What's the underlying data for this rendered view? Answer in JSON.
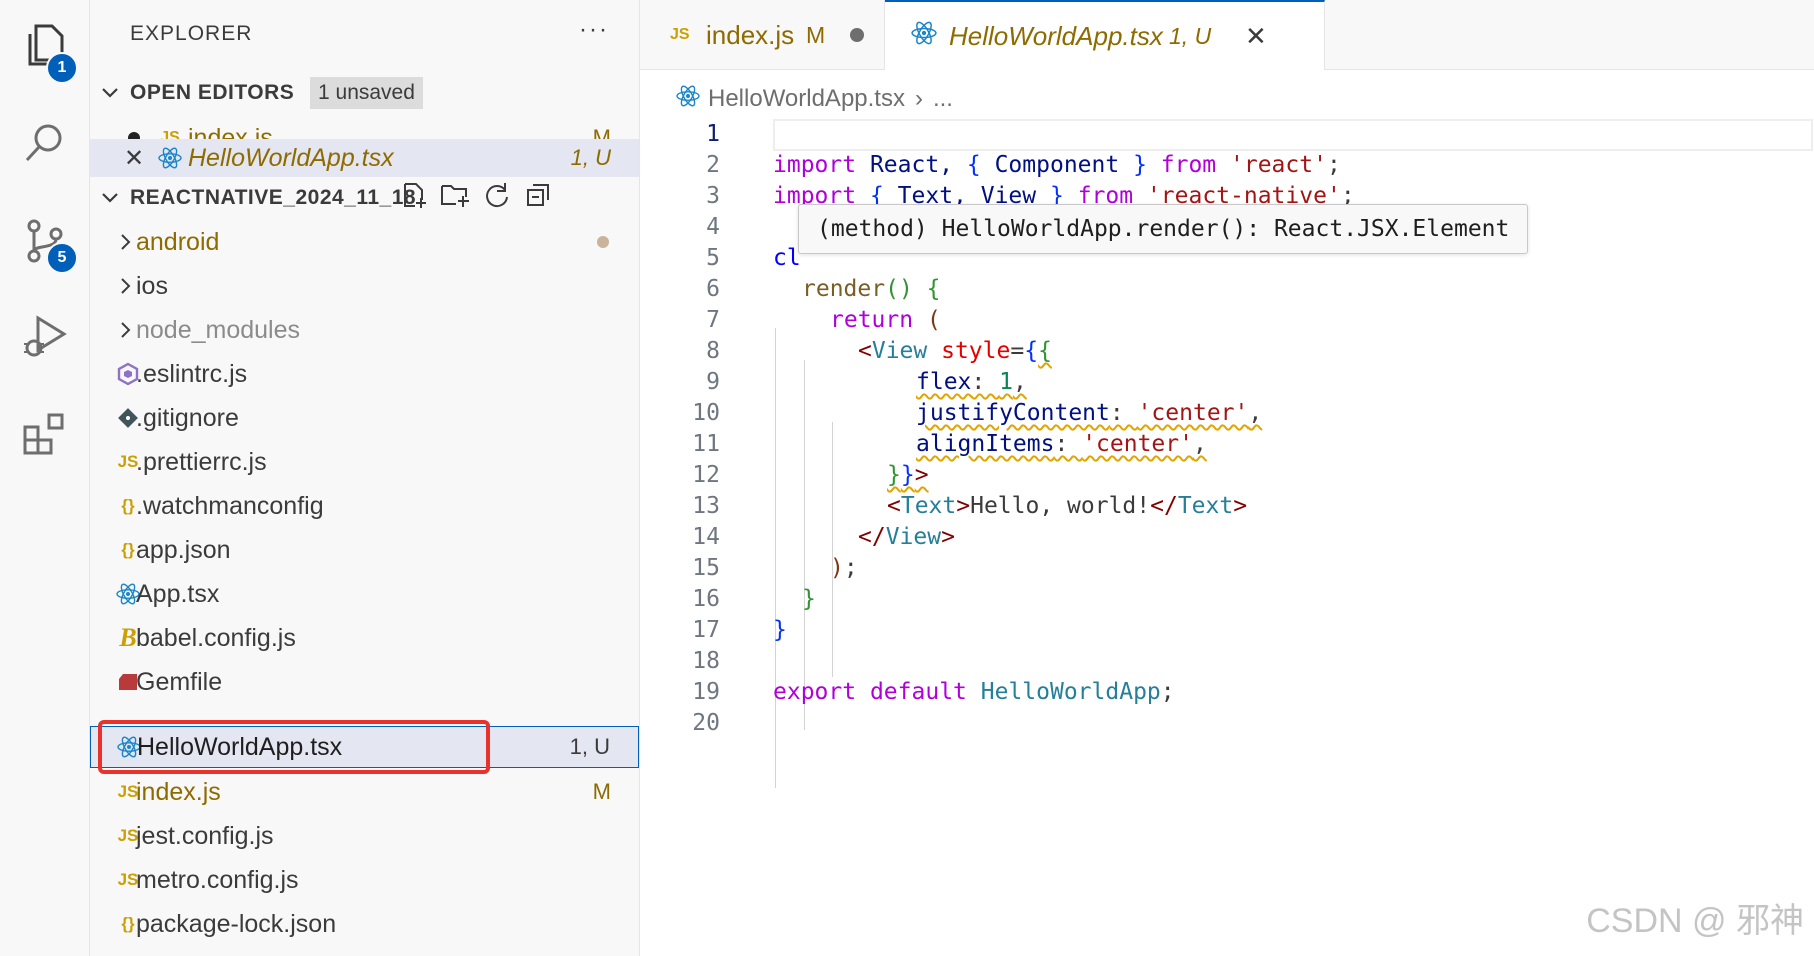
{
  "activity_bar": {
    "explorer_badge": "1",
    "scm_badge": "5"
  },
  "explorer": {
    "title": "EXPLORER",
    "more_label": "···",
    "open_editors": {
      "header": "OPEN EDITORS",
      "unsaved_badge": "1 unsaved",
      "items": [
        {
          "icon": "JS",
          "name": "index.js",
          "status": "M"
        },
        {
          "icon": "react",
          "name": "HelloWorldApp.tsx",
          "status": "1, U"
        }
      ]
    },
    "project": {
      "header": "REACTNATIVE_2024_11_18",
      "folders": [
        {
          "name": "android"
        },
        {
          "name": "ios"
        },
        {
          "name": "node_modules"
        }
      ],
      "files": [
        {
          "icon": "eslint",
          "name": ".eslintrc.js",
          "status": ""
        },
        {
          "icon": "git",
          "name": ".gitignore",
          "status": ""
        },
        {
          "icon": "JS",
          "name": ".prettierrc.js",
          "status": ""
        },
        {
          "icon": "{}",
          "name": ".watchmanconfig",
          "status": ""
        },
        {
          "icon": "{}",
          "name": "app.json",
          "status": ""
        },
        {
          "icon": "react",
          "name": "App.tsx",
          "status": ""
        },
        {
          "icon": "babel",
          "name": "babel.config.js",
          "status": ""
        },
        {
          "icon": "ruby",
          "name": "Gemfile",
          "status": ""
        },
        {
          "icon": "react",
          "name": "HelloWorldApp.tsx",
          "status": "1, U"
        },
        {
          "icon": "JS",
          "name": "index.js",
          "status": "M"
        },
        {
          "icon": "JS",
          "name": "jest.config.js",
          "status": ""
        },
        {
          "icon": "JS",
          "name": "metro.config.js",
          "status": ""
        },
        {
          "icon": "{}",
          "name": "package-lock.json",
          "status": ""
        }
      ]
    }
  },
  "tabs": [
    {
      "icon": "JS",
      "name": "index.js",
      "status": "M"
    },
    {
      "icon": "react",
      "name": "HelloWorldApp.tsx",
      "status": "1, U"
    }
  ],
  "breadcrumb": {
    "file": "HelloWorldApp.tsx",
    "sep": "›",
    "more": "..."
  },
  "editor": {
    "hover": "(method) HelloWorldApp.render(): React.JSX.Element",
    "line_numbers": [
      "1",
      "2",
      "3",
      "4",
      "5",
      "6",
      "7",
      "8",
      "9",
      "10",
      "11",
      "12",
      "13",
      "14",
      "15",
      "16",
      "17",
      "18",
      "19",
      "20"
    ],
    "code": {
      "l2": [
        "import",
        " React, ",
        "{",
        " Component ",
        "}",
        " from ",
        "'react'",
        ";"
      ],
      "l3": [
        "import",
        " ",
        "{",
        " Text, View ",
        "}",
        " from ",
        "'react-native'",
        ";"
      ],
      "l5": "cl",
      "l6": [
        "render",
        "()",
        " ",
        "{"
      ],
      "l7": [
        "return",
        " ",
        "("
      ],
      "l8": [
        "<",
        "View",
        " ",
        "style",
        "=",
        "{",
        "{"
      ],
      "l9": [
        "flex",
        ": ",
        "1",
        ","
      ],
      "l10": [
        "justifyContent",
        ": ",
        "'center'",
        ","
      ],
      "l11": [
        "alignItems",
        ": ",
        "'center'",
        ","
      ],
      "l12": [
        "}",
        "}",
        ">"
      ],
      "l13": [
        "<",
        "Text",
        ">",
        "Hello, world!",
        "</",
        "Text",
        ">"
      ],
      "l14": [
        "</",
        "View",
        ">"
      ],
      "l15": [
        ")",
        ";"
      ],
      "l16": "}",
      "l17": "}",
      "l19": [
        "export",
        " ",
        "default",
        " ",
        "HelloWorldApp",
        ";"
      ]
    }
  },
  "watermark": "CSDN @ 邪神",
  "colors": {
    "accent": "#005fb8",
    "modified": "#8e6b00",
    "highlight_box": "#e8322b"
  }
}
